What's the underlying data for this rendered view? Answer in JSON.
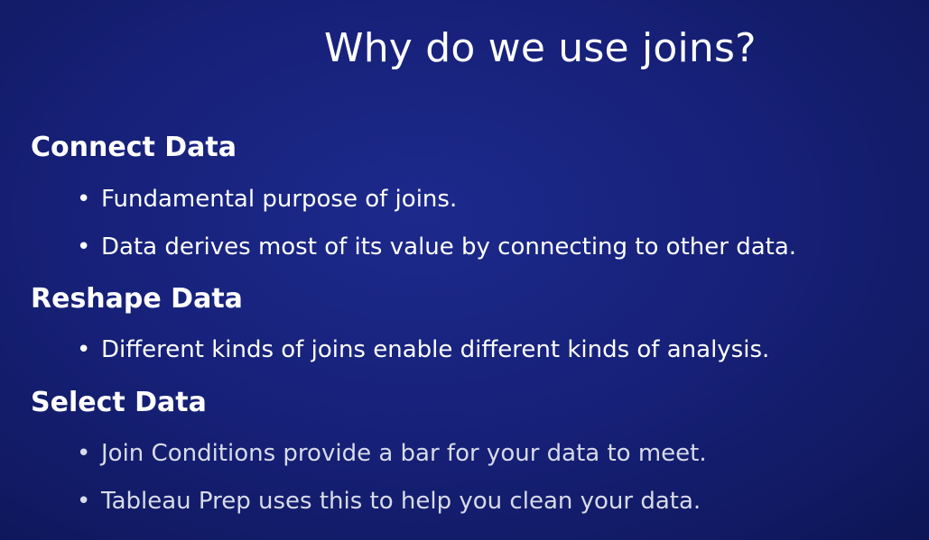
{
  "slide": {
    "title": "Why do we use joins?",
    "sections": [
      {
        "heading": "Connect Data",
        "bullets": [
          "Fundamental purpose of joins.",
          "Data derives most of its value by connecting to other data."
        ]
      },
      {
        "heading": "Reshape Data",
        "bullets": [
          "Different kinds of joins enable different kinds of analysis."
        ]
      },
      {
        "heading": "Select Data",
        "bullets": [
          "Join Conditions provide a bar for your data to meet.",
          "Tableau Prep uses this to help you clean your data."
        ]
      }
    ],
    "bullet_glyph": "•",
    "colors": {
      "background": "#17217a",
      "text": "#ffffff"
    }
  }
}
